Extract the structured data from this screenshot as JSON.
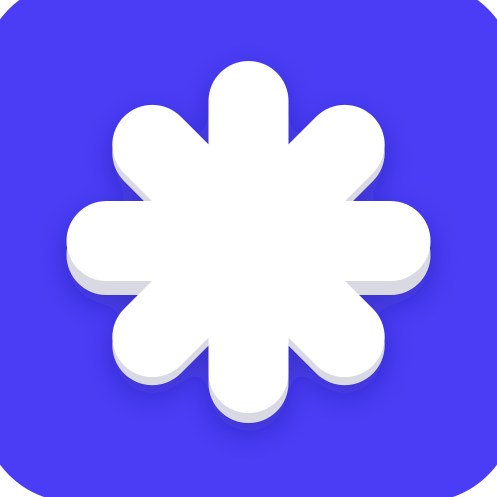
{
  "icon": {
    "name": "asterisk-app-icon",
    "background_color": "#4A3DF5",
    "glyph_color": "#FFFFFF",
    "glyph_shadow_color": "#D9D9E3"
  }
}
